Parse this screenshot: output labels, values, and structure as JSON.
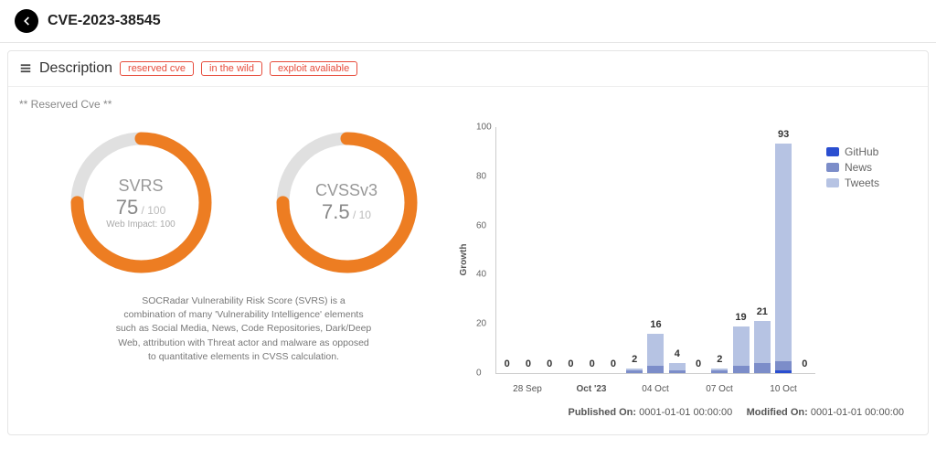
{
  "header": {
    "title": "CVE-2023-38545"
  },
  "panel": {
    "title": "Description",
    "tags": [
      "reserved cve",
      "in the wild",
      "exploit avaliable"
    ],
    "reserved_label": "** Reserved Cve **"
  },
  "gauges": {
    "svrs": {
      "title": "SVRS",
      "value": "75",
      "denom": " / 100",
      "sub": "Web Impact: 100",
      "pct": 75
    },
    "cvss": {
      "title": "CVSSv3",
      "value": "7.5",
      "denom": " / 10",
      "pct": 75
    },
    "desc": "SOCRadar Vulnerability Risk Score (SVRS) is a combination of many 'Vulnerability Intelligence' elements such as Social Media, News, Code Repositories, Dark/Deep Web, attribution with Threat actor and malware as opposed to quantitative elements in CVSS calculation."
  },
  "chart_data": {
    "type": "bar",
    "ylabel": "Growth",
    "ylim": [
      0,
      100
    ],
    "yticks": [
      0,
      20,
      40,
      60,
      80,
      100
    ],
    "series_names": [
      "GitHub",
      "News",
      "Tweets"
    ],
    "xlabels": [
      "",
      "28 Sep",
      "",
      "Oct '23",
      "",
      "04 Oct",
      "",
      "",
      "07 Oct",
      "",
      "",
      "10 Oct",
      "",
      ""
    ],
    "points": [
      {
        "total": 0,
        "github": 0,
        "news": 0,
        "tweets": 0
      },
      {
        "total": 0,
        "github": 0,
        "news": 0,
        "tweets": 0
      },
      {
        "total": 0,
        "github": 0,
        "news": 0,
        "tweets": 0
      },
      {
        "total": 0,
        "github": 0,
        "news": 0,
        "tweets": 0
      },
      {
        "total": 0,
        "github": 0,
        "news": 0,
        "tweets": 0
      },
      {
        "total": 0,
        "github": 0,
        "news": 0,
        "tweets": 0
      },
      {
        "total": 2,
        "github": 0,
        "news": 1,
        "tweets": 1
      },
      {
        "total": 16,
        "github": 0,
        "news": 3,
        "tweets": 13
      },
      {
        "total": 4,
        "github": 0,
        "news": 1,
        "tweets": 3
      },
      {
        "total": 0,
        "github": 0,
        "news": 0,
        "tweets": 0
      },
      {
        "total": 2,
        "github": 0,
        "news": 1,
        "tweets": 1
      },
      {
        "total": 19,
        "github": 0,
        "news": 3,
        "tweets": 16
      },
      {
        "total": 21,
        "github": 0,
        "news": 4,
        "tweets": 17
      },
      {
        "total": 93,
        "github": 1,
        "news": 4,
        "tweets": 88
      },
      {
        "total": 0,
        "github": 0,
        "news": 0,
        "tweets": 0
      }
    ]
  },
  "legend": {
    "github": "GitHub",
    "news": "News",
    "tweets": "Tweets"
  },
  "footer": {
    "published_label": "Published On:",
    "published_val": "0001-01-01 00:00:00",
    "modified_label": "Modified On:",
    "modified_val": "0001-01-01 00:00:00"
  }
}
